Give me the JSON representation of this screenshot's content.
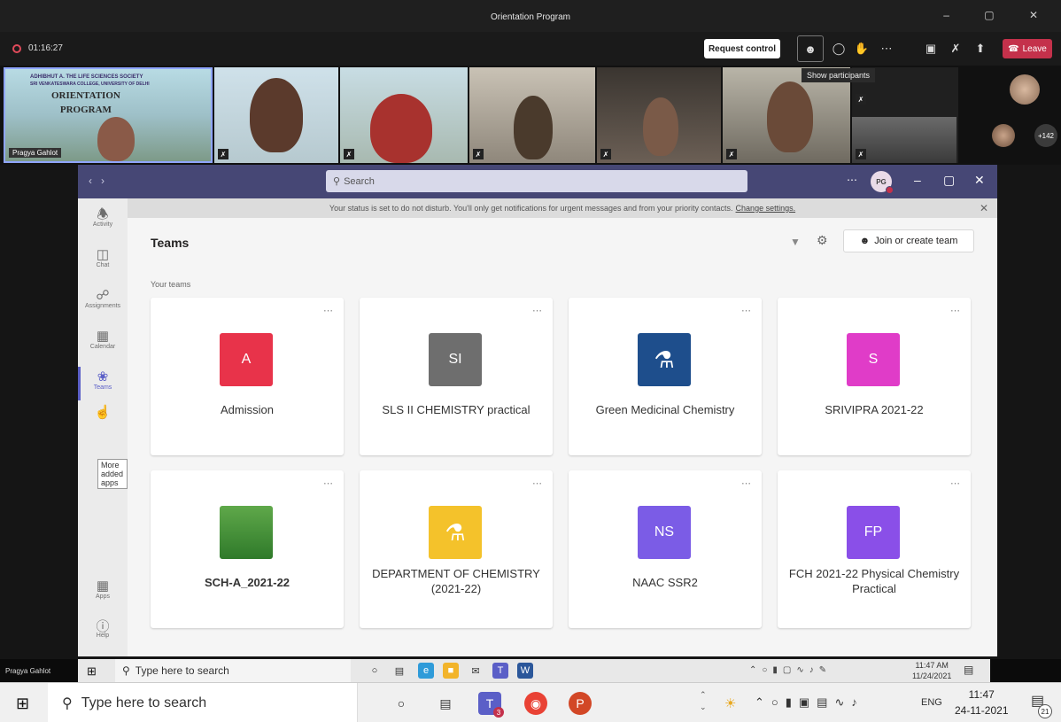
{
  "meeting": {
    "window_title": "Orientation Program",
    "window_controls": "–  ▢  ✕",
    "elapsed": "01:16:27",
    "request_control_label": "Request control",
    "participants_tooltip": "Show participants",
    "leave_label": "Leave",
    "presenter_name": "Pragya Gahlot",
    "more_participants": "+142",
    "banner_text": "ADHIBHUT A. THE LIFE SCIENCES SOCIETY",
    "banner_subtext": "SRI VENKATESWARA COLLEGE, UNIVERSITY OF DELHI",
    "slide_title_1": "ORIENTATION",
    "slide_title_2": "PROGRAM"
  },
  "teams": {
    "search_placeholder": "Search",
    "avatar_initials": "PG",
    "dnd_message": "Your status is set to do not disturb. You'll only get notifications for urgent messages and from your priority contacts.",
    "dnd_link": "Change settings.",
    "heading": "Teams",
    "join_create_label": "Join or create team",
    "your_teams_label": "Your teams",
    "rail": [
      {
        "label": "Activity",
        "icon": "bell-icon"
      },
      {
        "label": "Chat",
        "icon": "chat-icon"
      },
      {
        "label": "Assignments",
        "icon": "assignments-icon"
      },
      {
        "label": "Calendar",
        "icon": "calendar-icon"
      },
      {
        "label": "Teams",
        "icon": "teams-icon"
      },
      {
        "label": "Apps",
        "icon": "apps-icon"
      },
      {
        "label": "Help",
        "icon": "help-icon"
      }
    ],
    "more_apps_tooltip": "More added apps",
    "cards": [
      {
        "name": "Admission",
        "initials": "A",
        "color": "#e8334a"
      },
      {
        "name": "SLS II CHEMISTRY practical",
        "initials": "SI",
        "color": "#6e6e6e"
      },
      {
        "name": "Green Medicinal Chemistry",
        "initials": "",
        "color": "#1e4e8c"
      },
      {
        "name": "SRIVIPRA 2021-22",
        "initials": "S",
        "color": "#e03cc8"
      },
      {
        "name": "SCH-A_2021-22",
        "initials": "",
        "color": "#4f9a3a"
      },
      {
        "name": "DEPARTMENT OF CHEMISTRY (2021-22)",
        "initials": "",
        "color": "#f4c22b"
      },
      {
        "name": "NAAC SSR2",
        "initials": "NS",
        "color": "#7b5ce6"
      },
      {
        "name": "FCH 2021-22 Physical Chemistry Practical",
        "initials": "FP",
        "color": "#8a4fe8"
      }
    ]
  },
  "inner_taskbar": {
    "presenter_label": "Pragya Gahlot",
    "search_placeholder": "Type here to search",
    "time": "11:47 AM",
    "date": "11/24/2021"
  },
  "outer_taskbar": {
    "search_placeholder": "Type here to search",
    "lang": "ENG",
    "time": "11:47",
    "date": "24-11-2021",
    "notification_count": "21",
    "teams_badge": "3"
  }
}
